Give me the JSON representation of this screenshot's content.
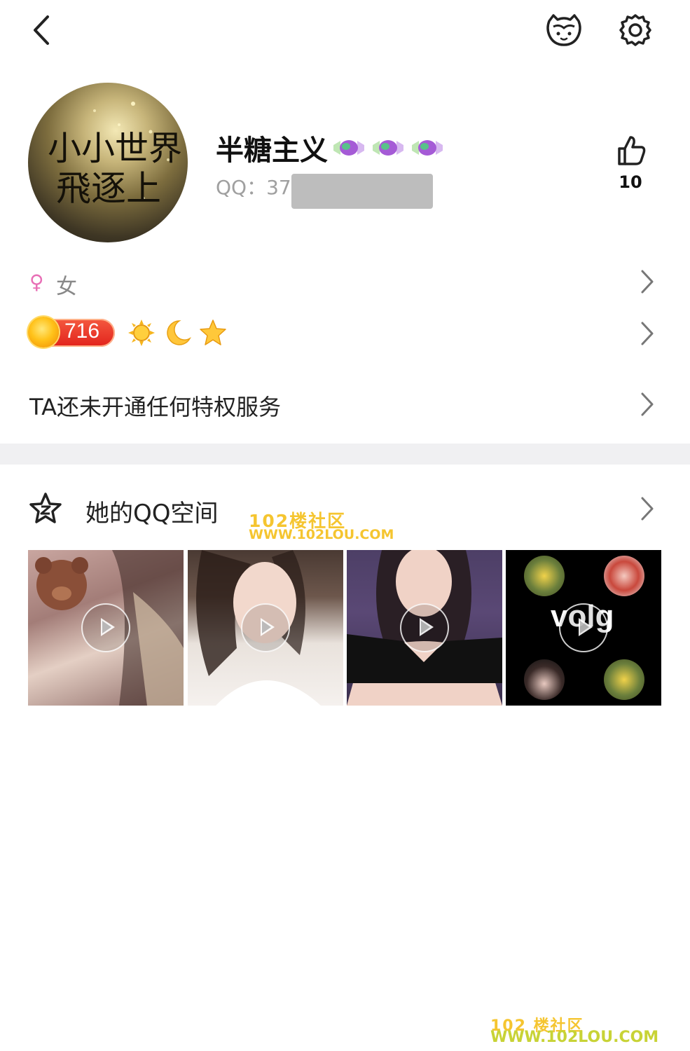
{
  "profile": {
    "nickname": "半糖主义",
    "qq_prefix": "QQ：37",
    "like_count": "10",
    "avatar_text_line1": "小小世界",
    "avatar_text_line2": "飛逐上"
  },
  "gender": {
    "symbol": "♀",
    "label": "女"
  },
  "level": {
    "value": "716"
  },
  "privilege": {
    "text": "TA还未开通任何特权服务"
  },
  "qzone": {
    "title": "她的QQ空间"
  },
  "thumbnails": [
    {
      "overlay": ""
    },
    {
      "overlay": ""
    },
    {
      "overlay": ""
    },
    {
      "overlay": "volg"
    }
  ],
  "watermark": {
    "line1": "102楼社区",
    "line2": "WWW.102LOU.COM",
    "footer_line1": "102 楼社区",
    "footer_line2": "WWW.102LOU.COM"
  },
  "colors": {
    "gender_accent": "#e86fb6",
    "level_badge": "#e2231c",
    "divider": "#f0f0f2",
    "watermark": "#f5c530"
  },
  "icons": [
    "back-icon",
    "pet-icon",
    "settings-icon",
    "thumbs-up-icon",
    "chevron-right-icon",
    "qzone-star-icon",
    "play-icon",
    "candy-icon",
    "sun-icon",
    "moon-icon",
    "star-icon",
    "level-coin-icon"
  ]
}
